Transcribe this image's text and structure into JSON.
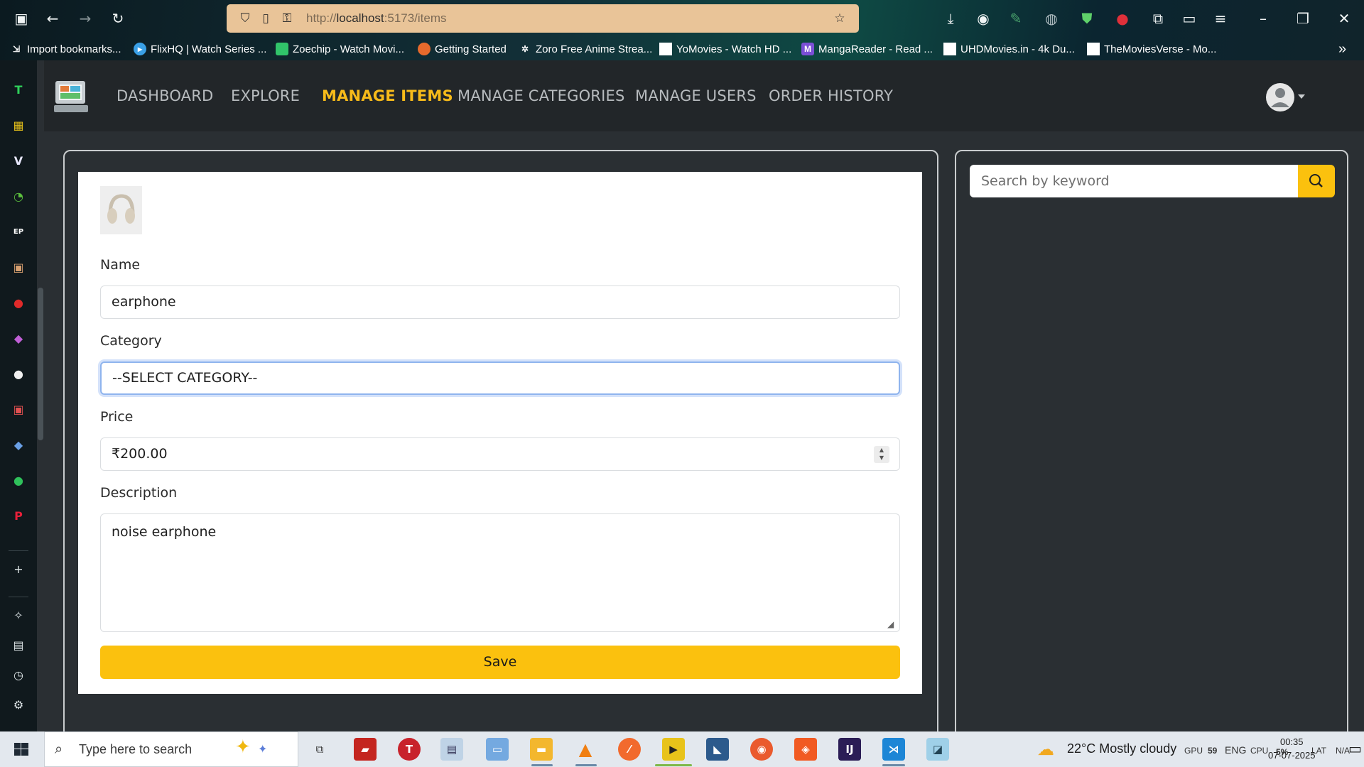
{
  "browser": {
    "url_prefix": "http://",
    "url_host": "localhost",
    "url_rest": ":5173/items",
    "bookmarks": [
      {
        "label": "Import bookmarks...",
        "icon": "import-icon",
        "color": "#ffffff"
      },
      {
        "label": "FlixHQ | Watch Series ...",
        "icon": "flixhq-icon",
        "color": "#3aa0e6"
      },
      {
        "label": "Zoechip - Watch Movi...",
        "icon": "zoechip-icon",
        "color": "#31c46a"
      },
      {
        "label": "Getting Started",
        "icon": "firefox-icon",
        "color": "#e66a2c"
      },
      {
        "label": "Zoro Free Anime Strea...",
        "icon": "zoro-icon",
        "color": "#8a8a8a"
      },
      {
        "label": "YoMovies - Watch HD ...",
        "icon": "page-icon",
        "color": "#ffffff"
      },
      {
        "label": "MangaReader - Read ...",
        "icon": "mangareader-icon",
        "color": "#7b4fd6"
      },
      {
        "label": "UHDMovies.in - 4k Du...",
        "icon": "page-icon",
        "color": "#ffffff"
      },
      {
        "label": "TheMoviesVerse - Mo...",
        "icon": "page-icon",
        "color": "#ffffff"
      }
    ]
  },
  "nav": {
    "links": [
      "DASHBOARD",
      "EXPLORE",
      "MANAGE ITEMS",
      "MANAGE CATEGORIES",
      "MANAGE USERS",
      "ORDER HISTORY"
    ],
    "active": "MANAGE ITEMS",
    "accent": "#f7bb1a"
  },
  "form": {
    "name_label": "Name",
    "name_value": "earphone",
    "category_label": "Category",
    "category_value": "--SELECT CATEGORY--",
    "price_label": "Price",
    "price_value": "₹200.00",
    "description_label": "Description",
    "description_value": "noise earphone",
    "save_label": "Save",
    "button_color": "#fbc10e"
  },
  "search": {
    "placeholder": "Search by keyword"
  },
  "taskbar": {
    "search_placeholder": "Type here to search",
    "weather": "22°C  Mostly cloudy",
    "gpu": "GPU",
    "gpu_value": "59",
    "lang": "ENG",
    "cpu": "CPU",
    "cpu_value": "5%",
    "lat": "LAT",
    "lat_value": "N/A",
    "time": "00:35",
    "date": "07-07-2025"
  }
}
